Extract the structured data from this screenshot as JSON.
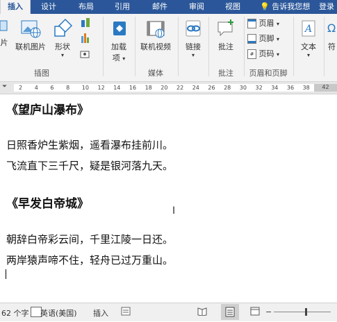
{
  "tabs": [
    "插入",
    "设计",
    "布局",
    "引用",
    "邮件",
    "审阅",
    "视图"
  ],
  "tell_me": "告诉我您想",
  "signin": "登录",
  "ribbon": {
    "buttons": {
      "partial_left": "片",
      "online_pictures": "联机图片",
      "shapes": "形状",
      "addins": "加载",
      "addins2": "项",
      "online_video": "联机视频",
      "link": "链接",
      "comment": "批注",
      "header": "页眉",
      "footer": "页脚",
      "page_number": "页码",
      "text": "文本",
      "symbol_partial": "符"
    },
    "groups": {
      "illustrations": "插图",
      "media": "媒体",
      "comments": "批注",
      "header_footer": "页眉和页脚"
    }
  },
  "ruler": {
    "ticks": [
      "2",
      "4",
      "6",
      "8",
      "10",
      "12",
      "14",
      "16",
      "18",
      "20",
      "22",
      "24",
      "26",
      "28",
      "30",
      "32",
      "34",
      "36",
      "38"
    ],
    "end_tick": "42"
  },
  "document": {
    "title1": "《望庐山瀑布》",
    "poem1_line1": "日照香炉生紫烟，遥看瀑布挂前川。",
    "poem1_line2": "飞流直下三千尺，疑是银河落九天。",
    "title2": "《早发白帝城》",
    "poem2_line1": "朝辞白帝彩云间，千里江陵一日还。",
    "poem2_line2": "两岸猿声啼不住，轻舟已过万重山。"
  },
  "status": {
    "word_count": "62 个字",
    "language": "英语(美国)",
    "mode": "插入"
  },
  "colors": {
    "accent": "#2b579a"
  }
}
